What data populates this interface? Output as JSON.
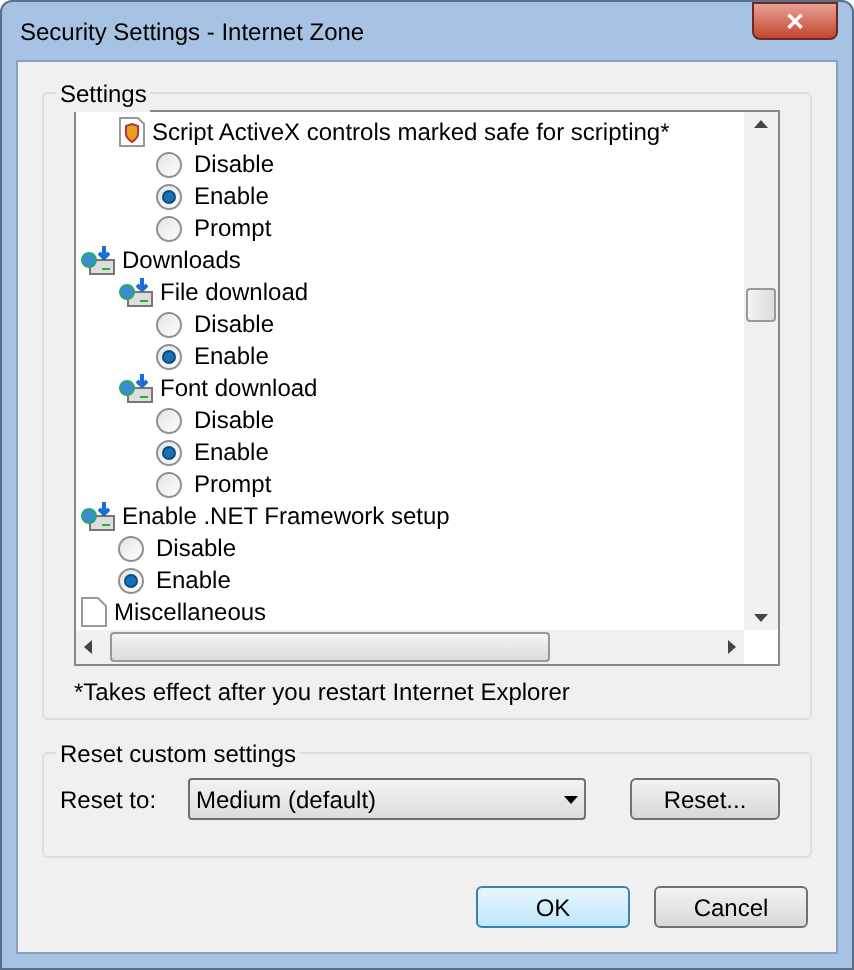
{
  "window": {
    "title": "Security Settings - Internet Zone",
    "close": "✕"
  },
  "settings": {
    "label": "Settings",
    "tree": [
      {
        "kind": "continued",
        "children": [
          {
            "kind": "script",
            "label": "Script ActiveX controls marked safe for scripting*",
            "children": [
              {
                "kind": "radio",
                "label": "Disable",
                "selected": false
              },
              {
                "kind": "radio",
                "label": "Enable",
                "selected": true
              },
              {
                "kind": "radio",
                "label": "Prompt",
                "selected": false
              }
            ]
          }
        ]
      },
      {
        "kind": "download",
        "label": "Downloads",
        "children": [
          {
            "kind": "download",
            "label": "File download",
            "children": [
              {
                "kind": "radio",
                "label": "Disable",
                "selected": false
              },
              {
                "kind": "radio",
                "label": "Enable",
                "selected": true
              }
            ]
          },
          {
            "kind": "download",
            "label": "Font download",
            "children": [
              {
                "kind": "radio",
                "label": "Disable",
                "selected": false
              },
              {
                "kind": "radio",
                "label": "Enable",
                "selected": true
              },
              {
                "kind": "radio",
                "label": "Prompt",
                "selected": false
              }
            ]
          }
        ]
      },
      {
        "kind": "download",
        "label": "Enable .NET Framework setup",
        "children": [
          {
            "kind": "radio",
            "label": "Disable",
            "selected": false
          },
          {
            "kind": "radio",
            "label": "Enable",
            "selected": true
          }
        ]
      },
      {
        "kind": "page",
        "label": "Miscellaneous"
      }
    ],
    "note": "*Takes effect after you restart Internet Explorer"
  },
  "reset": {
    "label": "Reset custom settings",
    "field_label": "Reset to:",
    "value": "Medium (default)",
    "button": "Reset..."
  },
  "buttons": [
    {
      "label": "OK",
      "default": true
    },
    {
      "label": "Cancel",
      "default": false
    }
  ]
}
